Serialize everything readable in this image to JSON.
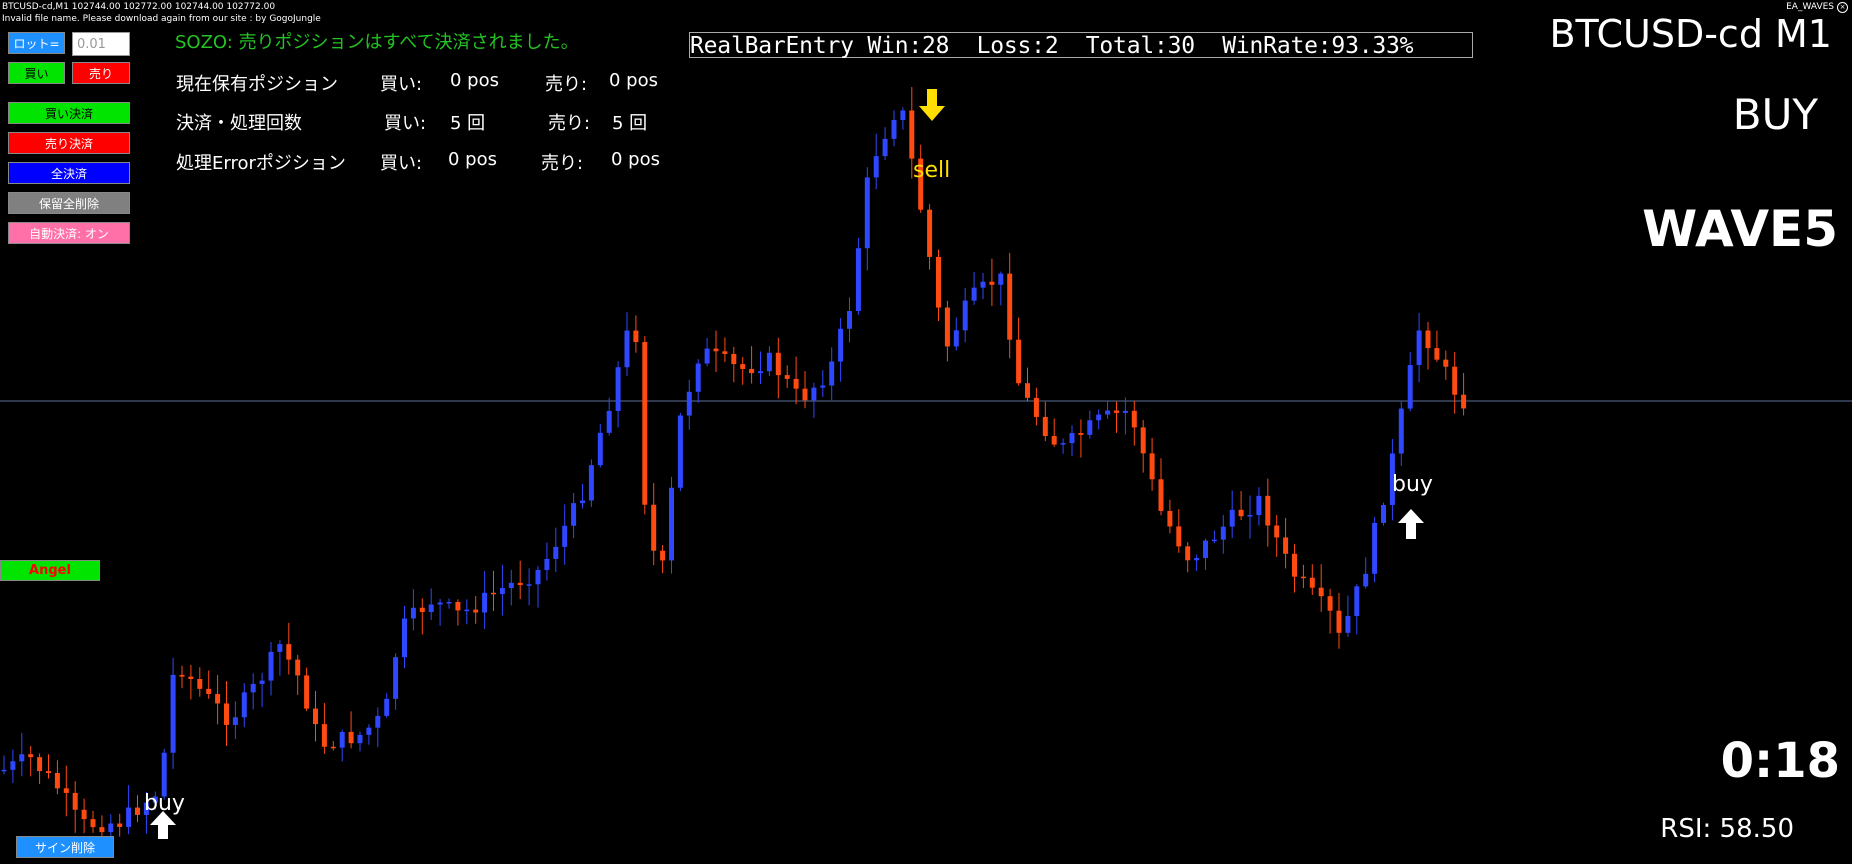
{
  "header": {
    "symbol_line": "BTCUSD-cd,M1",
    "ohlc": "102744.00 102772.00 102744.00 102772.00",
    "notice": "Invalid file name. Please download again from our site : by GogoJungle",
    "ea_name": "EA_WAVES"
  },
  "panel": {
    "lot_label": "ロット=",
    "lot_value": "0.01",
    "buy": "買い",
    "sell": "売り",
    "close_buy": "買い決済",
    "close_sell": "売り決済",
    "close_all": "全決済",
    "delete_pending": "保留全削除",
    "auto_close": "自動決済: オン",
    "angel": "Angel",
    "delete_sign": "サイン削除"
  },
  "status": {
    "message": "SOZO:  売りポジションはすべて決済されました。",
    "rows": [
      {
        "label": "現在保有ポジション",
        "buy_label": "買い:",
        "buy_val": "0 pos",
        "sell_label": "売り:",
        "sell_val": "0 pos"
      },
      {
        "label": "決済・処理回数",
        "buy_label": "買い:",
        "buy_val": "5 回",
        "sell_label": "売り:",
        "sell_val": "5 回"
      },
      {
        "label": "処理Errorポジション",
        "buy_label": "買い:",
        "buy_val": "0 pos",
        "sell_label": "売り:",
        "sell_val": "0 pos"
      }
    ]
  },
  "stats": {
    "text": "RealBarEntry Win:28  Loss:2  Total:30  WinRate:93.33%"
  },
  "right": {
    "symbol": "BTCUSD-cd M1",
    "signal": "BUY",
    "wave": "WAVE5",
    "timer": "0:18",
    "rsi": "RSI: 58.50"
  },
  "signals": {
    "buy1": "buy",
    "sell1": "sell",
    "buy2": "buy"
  },
  "colors": {
    "bull": "#2f47ff",
    "bear": "#ff4a12",
    "price_line": "#5a6f98",
    "sell_arrow": "#ffdf00",
    "status_green": "#22c322"
  },
  "chart_data": {
    "type": "candlestick",
    "bars": 165,
    "current_price": 102772.0,
    "trend": "low start, rising to peak near bar 80, falling to trough near bar 118, rising to end"
  }
}
